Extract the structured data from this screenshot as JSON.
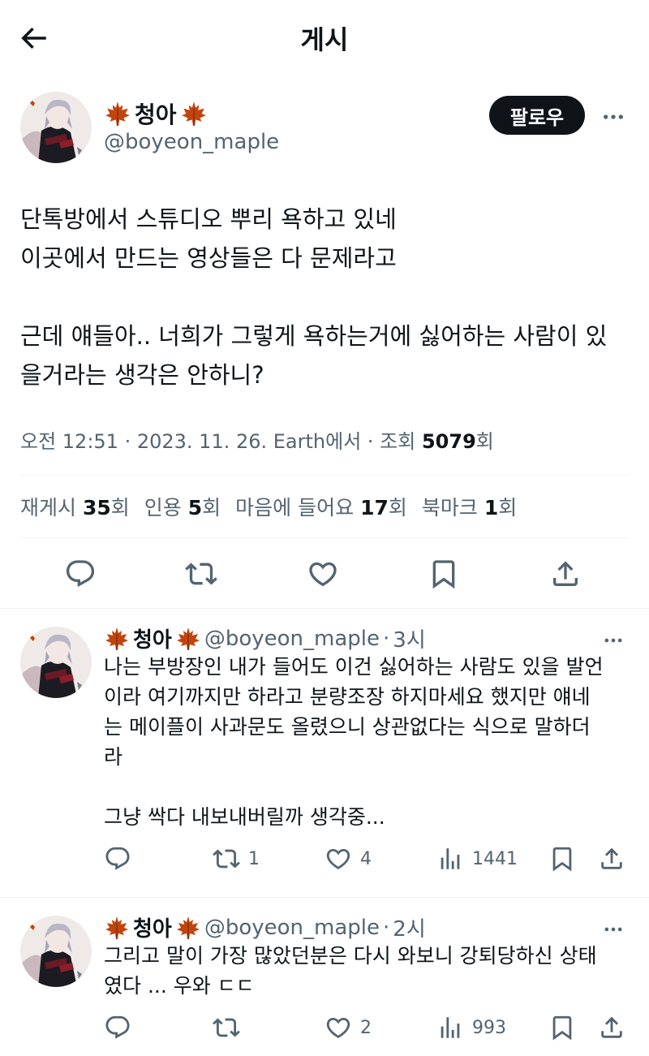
{
  "header": {
    "title": "게시"
  },
  "main_post": {
    "name": "청아",
    "handle": "@boyeon_maple",
    "follow_label": "팔로우",
    "text": "단톡방에서 스튜디오 뿌리 욕하고 있네\n이곳에서 만드는 영상들은 다 문제라고\n\n근데 얘들아.. 너희가 그렇게 욕하는거에 싫어하는 사람이 있\n을거라는 생각은 안하니?",
    "meta_prefix": "오전 12:51 · 2023. 11. 26. Earth에서 · 조회 ",
    "views": "5079",
    "views_suffix": "회",
    "stats": [
      {
        "label": "재게시",
        "value": "35",
        "suffix": "회"
      },
      {
        "label": "인용",
        "value": "5",
        "suffix": "회"
      },
      {
        "label": "마음에 들어요",
        "value": "17",
        "suffix": "회"
      },
      {
        "label": "북마크",
        "value": "1",
        "suffix": "회"
      }
    ]
  },
  "replies": [
    {
      "name": "청아",
      "handle": "@boyeon_maple",
      "time": "3시",
      "text": "나는 부방장인 내가 들어도 이건 싫어하는 사람도 있을 발언\n이라 여기까지만 하라고 분량조장 하지마세요 했지만 얘네\n는 메이플이 사과문도 올렸으니 상관없다는 식으로 말하더\n라\n\n그냥 싹다 내보내버릴까 생각중...",
      "retweets": "1",
      "likes": "4",
      "views": "1441"
    },
    {
      "name": "청아",
      "handle": "@boyeon_maple",
      "time": "2시",
      "text": "그리고 말이 가장 많았던분은 다시 와보니 강퇴당하신 상태\n였다 ... 우와 ㄷㄷ",
      "retweets": "",
      "likes": "2",
      "views": "993"
    }
  ],
  "icons": {
    "back": "arrow-left-icon",
    "more": "more-dots-icon",
    "maple": "maple-leaf-icon",
    "reply": "reply-icon",
    "retweet": "retweet-icon",
    "like": "heart-icon",
    "views": "views-bar-icon",
    "bookmark": "bookmark-icon",
    "share": "share-icon"
  },
  "colors": {
    "text": "#0f1419",
    "muted": "#536471",
    "maple": "#c1440e",
    "divider": "#eff3f4"
  }
}
